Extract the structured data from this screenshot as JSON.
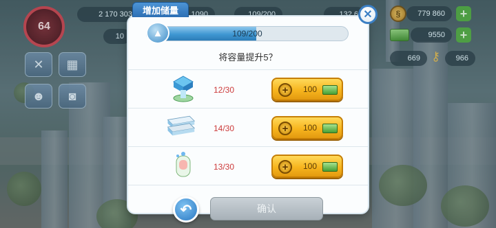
{
  "hud": {
    "level": "64",
    "population": "2 170 303",
    "left_counter_2": "10",
    "middle_value_1": "1090",
    "middle_value_2": "109/200",
    "middle_value_3": "132 6",
    "simoleons": "779 860",
    "simcash": "9550",
    "keys_a": "669",
    "keys_b": "966"
  },
  "dialog": {
    "tab_title": "增加储量",
    "capacity_text": "109/200",
    "capacity_fraction": 0.545,
    "prompt": "将容量提升5？",
    "items": [
      {
        "name": "storage-lock-item",
        "icon": "lock-icon",
        "count": "12/30",
        "price": "100"
      },
      {
        "name": "storage-bar-item",
        "icon": "bar-icon",
        "count": "14/30",
        "price": "100"
      },
      {
        "name": "storage-pipe-item",
        "icon": "pipe-icon",
        "count": "13/30",
        "price": "100"
      }
    ],
    "confirm_label": "确认",
    "back_icon": "back-arrow-icon",
    "close_icon": "close-icon"
  },
  "colors": {
    "tab_blue": "#2d6fb4",
    "buy_gold": "#f7b51e",
    "count_red": "#cc3a3a"
  }
}
